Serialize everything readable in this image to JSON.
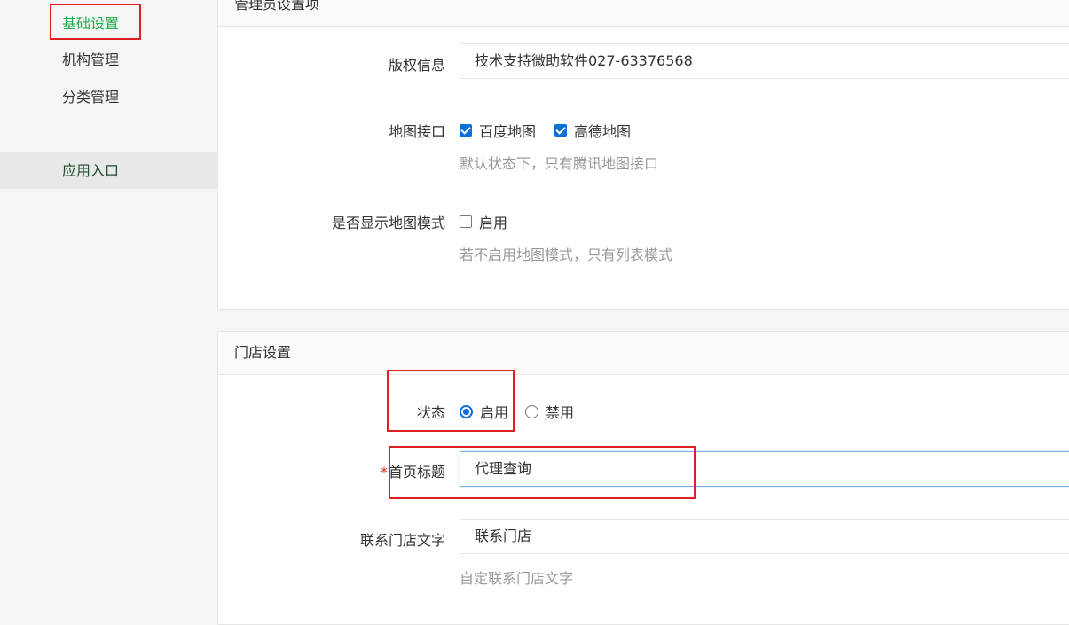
{
  "sidebar": {
    "items": [
      {
        "label": "基础设置"
      },
      {
        "label": "机构管理"
      },
      {
        "label": "分类管理"
      },
      {
        "label": "应用入口"
      }
    ]
  },
  "admin_panel": {
    "title": "管理员设置项",
    "copyright": {
      "label": "版权信息",
      "value": "技术支持微助软件027-63376568"
    },
    "map_api": {
      "label": "地图接口",
      "options": [
        {
          "label": "百度地图",
          "checked": true
        },
        {
          "label": "高德地图",
          "checked": true
        }
      ],
      "hint": "默认状态下，只有腾讯地图接口"
    },
    "map_mode": {
      "label": "是否显示地图模式",
      "option": {
        "label": "启用",
        "checked": false
      },
      "hint": "若不启用地图模式，只有列表模式"
    }
  },
  "store_panel": {
    "title": "门店设置",
    "status": {
      "label": "状态",
      "options": [
        {
          "label": "启用",
          "checked": true
        },
        {
          "label": "禁用",
          "checked": false
        }
      ]
    },
    "home_title": {
      "required_mark": "*",
      "label": "首页标题",
      "value": "代理查询"
    },
    "contact_text": {
      "label": "联系门店文字",
      "value": "联系门店",
      "hint": "自定联系门店文字"
    }
  },
  "colors": {
    "accent_green": "#1aad4c",
    "checkbox_blue": "#0b6fd8",
    "annotation_red": "#e02020"
  }
}
